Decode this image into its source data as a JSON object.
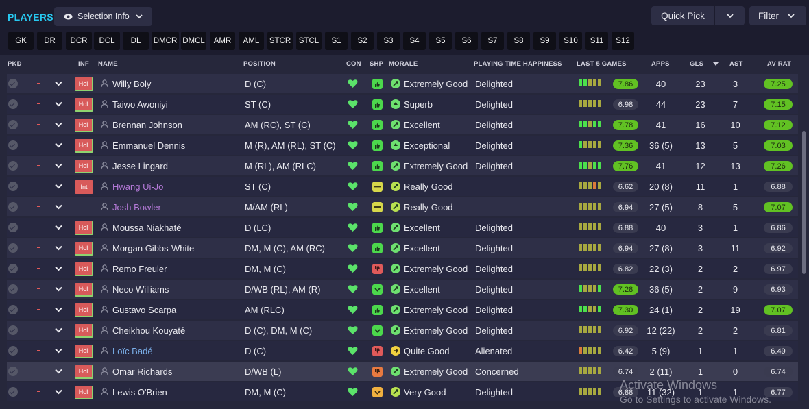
{
  "header": {
    "title": "PLAYERS",
    "selection_info": "Selection Info",
    "quick_pick": "Quick Pick",
    "filter": "Filter"
  },
  "position_filters": [
    "GK",
    "DR",
    "DCR",
    "DCL",
    "DL",
    "DMCR",
    "DMCL",
    "AMR",
    "AML",
    "STCR",
    "STCL",
    "S1",
    "S2",
    "S3",
    "S4",
    "S5",
    "S6",
    "S7",
    "S8",
    "S9",
    "S10",
    "S11",
    "S12"
  ],
  "columns": {
    "pkd": "PKD",
    "inf": "INF",
    "name": "NAME",
    "position": "POSITION",
    "con": "CON",
    "shp": "SHP",
    "morale": "MORALE",
    "happiness": "PLAYING TIME HAPPINESS",
    "last5": "LAST 5 GAMES",
    "apps": "APPS",
    "gls": "GLS",
    "ast": "AST",
    "avrat": "AV RAT"
  },
  "colors": {
    "accent": "#27c8f0",
    "rating_good": "#61c123",
    "injury_badge": "#d85a5a",
    "condition_heart": "#5be36a",
    "form_green": "#4ce04c",
    "form_olive": "#a7a840",
    "form_orange": "#d97a3a"
  },
  "players": [
    {
      "inf": "Hol",
      "name": "Willy Boly",
      "position": "D (C)",
      "shp": "thumbs-up",
      "morale": "Extremely Good",
      "happiness": "Delighted",
      "form": [
        "g",
        "g",
        "o",
        "o",
        "o"
      ],
      "form_rating": "7.86",
      "form_good": true,
      "apps": "40",
      "gls": "23",
      "ast": "3",
      "av_rat": "7.25",
      "av_good": true
    },
    {
      "inf": "Hol",
      "name": "Taiwo Awoniyi",
      "position": "ST (C)",
      "shp": "thumbs-up",
      "morale": "Superb",
      "happiness": "Delighted",
      "form": [
        "o",
        "o",
        "o",
        "o",
        "o"
      ],
      "form_rating": "6.98",
      "form_good": false,
      "apps": "44",
      "gls": "23",
      "ast": "7",
      "av_rat": "7.15",
      "av_good": true
    },
    {
      "inf": "Hol",
      "name": "Brennan Johnson",
      "position": "AM (RC), ST (C)",
      "shp": "thumbs-up",
      "morale": "Excellent",
      "happiness": "Delighted",
      "form": [
        "g",
        "g",
        "o",
        "g",
        "g"
      ],
      "form_rating": "7.78",
      "form_good": true,
      "apps": "41",
      "gls": "16",
      "ast": "10",
      "av_rat": "7.12",
      "av_good": true
    },
    {
      "inf": "Hol",
      "name": "Emmanuel Dennis",
      "position": "M (R), AM (RL), ST (C)",
      "shp": "thumbs-up",
      "morale": "Exceptional",
      "happiness": "Delighted",
      "form": [
        "g",
        "o",
        "o",
        "o",
        "o"
      ],
      "form_rating": "7.36",
      "form_good": true,
      "apps": "36 (5)",
      "gls": "13",
      "ast": "5",
      "av_rat": "7.03",
      "av_good": true
    },
    {
      "inf": "Hol",
      "name": "Jesse Lingard",
      "position": "M (RL), AM (RLC)",
      "shp": "thumbs-up",
      "morale": "Extremely Good",
      "happiness": "Delighted",
      "form": [
        "g",
        "g",
        "o",
        "g",
        "g"
      ],
      "form_rating": "7.76",
      "form_good": true,
      "apps": "41",
      "gls": "12",
      "ast": "13",
      "av_rat": "7.26",
      "av_good": true
    },
    {
      "inf": "Int",
      "name": "Hwang Ui-Jo",
      "position": "ST (C)",
      "shp": "neutral",
      "morale": "Really Good",
      "happiness": "",
      "form": [
        "o",
        "o",
        "o",
        "r",
        "o"
      ],
      "form_rating": "6.62",
      "form_good": false,
      "apps": "20 (8)",
      "gls": "11",
      "ast": "1",
      "av_rat": "6.88",
      "av_good": false
    },
    {
      "inf": "",
      "name": "Josh Bowler",
      "position": "M/AM (RL)",
      "shp": "neutral",
      "morale": "Really Good",
      "happiness": "",
      "form": [
        "o",
        "o",
        "o",
        "o",
        "o"
      ],
      "form_rating": "6.94",
      "form_good": false,
      "apps": "27 (5)",
      "gls": "8",
      "ast": "5",
      "av_rat": "7.07",
      "av_good": true
    },
    {
      "inf": "Hol",
      "name": "Moussa Niakhaté",
      "position": "D (LC)",
      "shp": "thumbs-up",
      "morale": "Excellent",
      "happiness": "Delighted",
      "form": [
        "o",
        "o",
        "o",
        "o",
        "o"
      ],
      "form_rating": "6.88",
      "form_good": false,
      "apps": "40",
      "gls": "3",
      "ast": "1",
      "av_rat": "6.86",
      "av_good": false
    },
    {
      "inf": "Hol",
      "name": "Morgan Gibbs-White",
      "position": "DM, M (C), AM (RC)",
      "shp": "thumbs-up",
      "morale": "Excellent",
      "happiness": "Delighted",
      "form": [
        "o",
        "o",
        "o",
        "o",
        "o"
      ],
      "form_rating": "6.94",
      "form_good": false,
      "apps": "27 (8)",
      "gls": "3",
      "ast": "11",
      "av_rat": "6.92",
      "av_good": false
    },
    {
      "inf": "Hol",
      "name": "Remo Freuler",
      "position": "DM, M (C)",
      "shp": "thumbs-down",
      "morale": "Extremely Good",
      "happiness": "Delighted",
      "form": [
        "o",
        "o",
        "o",
        "o",
        "o"
      ],
      "form_rating": "6.82",
      "form_good": false,
      "apps": "22 (3)",
      "gls": "2",
      "ast": "2",
      "av_rat": "6.97",
      "av_good": false
    },
    {
      "inf": "Hol",
      "name": "Neco Williams",
      "position": "D/WB (RL), AM (R)",
      "shp": "chevron-down",
      "morale": "Excellent",
      "happiness": "Delighted",
      "form": [
        "g",
        "o",
        "o",
        "o",
        "g"
      ],
      "form_rating": "7.28",
      "form_good": true,
      "apps": "36 (5)",
      "gls": "2",
      "ast": "9",
      "av_rat": "6.93",
      "av_good": false
    },
    {
      "inf": "Hol",
      "name": "Gustavo Scarpa",
      "position": "AM (RLC)",
      "shp": "thumbs-up",
      "morale": "Extremely Good",
      "happiness": "Delighted",
      "form": [
        "g",
        "g",
        "o",
        "o",
        "g"
      ],
      "form_rating": "7.30",
      "form_good": true,
      "apps": "24 (1)",
      "gls": "2",
      "ast": "19",
      "av_rat": "7.07",
      "av_good": true
    },
    {
      "inf": "Hol",
      "name": "Cheikhou Kouyaté",
      "position": "D (C), DM, M (C)",
      "shp": "chevron-down",
      "morale": "Extremely Good",
      "happiness": "Delighted",
      "form": [
        "o",
        "o",
        "o",
        "o",
        "o"
      ],
      "form_rating": "6.92",
      "form_good": false,
      "apps": "12 (22)",
      "gls": "2",
      "ast": "2",
      "av_rat": "6.81",
      "av_good": false
    },
    {
      "inf": "Hol",
      "name": "Loïc Badé",
      "position": "D (C)",
      "shp": "thumbs-down",
      "morale": "Quite Good",
      "happiness": "Alienated",
      "form": [
        "r",
        "o",
        "o",
        "o",
        "o"
      ],
      "form_rating": "6.42",
      "form_good": false,
      "apps": "5 (9)",
      "gls": "1",
      "ast": "1",
      "av_rat": "6.49",
      "av_good": false
    },
    {
      "inf": "Hol",
      "name": "Omar Richards",
      "position": "D/WB (L)",
      "shp": "thumbs-down-orange",
      "morale": "Extremely Good",
      "happiness": "Concerned",
      "form": [
        "o",
        "o",
        "o",
        "o",
        "o"
      ],
      "form_rating": "6.74",
      "form_good": false,
      "apps": "2 (11)",
      "gls": "1",
      "ast": "0",
      "av_rat": "6.74",
      "av_good": false
    },
    {
      "inf": "Hol",
      "name": "Lewis O'Brien",
      "position": "DM, M (C)",
      "shp": "chevron-down-orange",
      "morale": "Very Good",
      "happiness": "Delighted",
      "form": [
        "o",
        "o",
        "o",
        "o",
        "o"
      ],
      "form_rating": "6.88",
      "form_good": false,
      "apps": "11 (32)",
      "gls": "1",
      "ast": "1",
      "av_rat": "6.77",
      "av_good": false
    }
  ],
  "watermark": {
    "line1": "Activate Windows",
    "line2": "Go to Settings to activate Windows."
  }
}
